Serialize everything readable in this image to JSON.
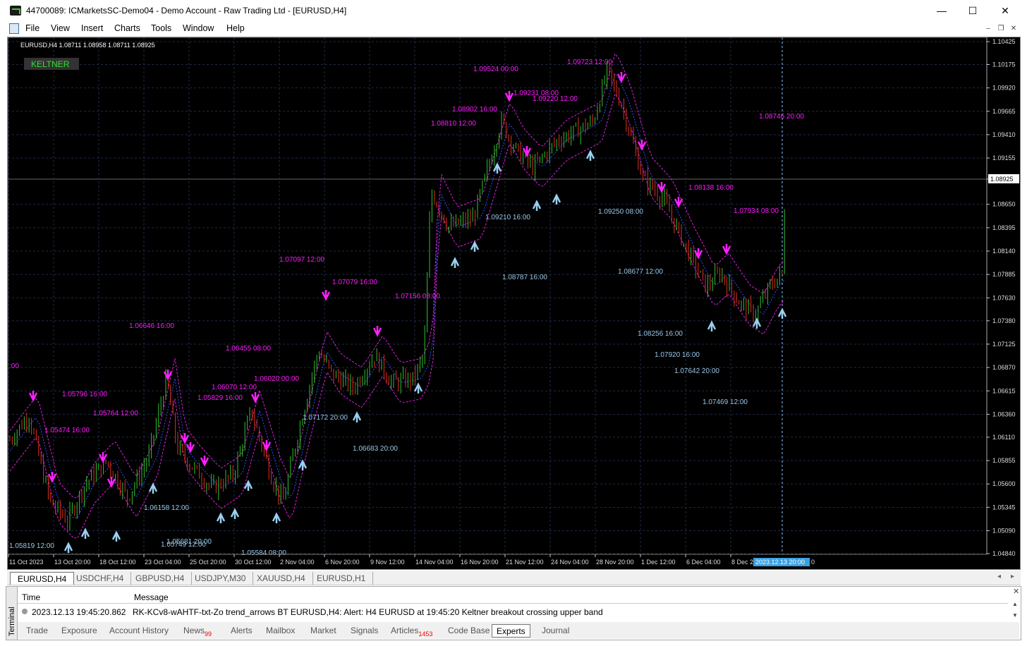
{
  "window": {
    "title": "44700089: ICMarketsSC-Demo04 - Demo Account - Raw Trading Ltd - [EURUSD,H4]",
    "minimize": "—",
    "maximize": "☐",
    "close": "✕"
  },
  "menu": [
    "File",
    "View",
    "Insert",
    "Charts",
    "Tools",
    "Window",
    "Help"
  ],
  "chart": {
    "header": "EURUSD,H4  1.08711 1.08958 1.08711 1.08925",
    "indicator_badge": "KELTNER",
    "current_price": "1.08925",
    "cursor_time": "2023.12.13 20:00",
    "price_axis": [
      "1.10425",
      "1.10175",
      "1.09920",
      "1.09665",
      "1.09410",
      "1.09155",
      "1.08925",
      "1.08650",
      "1.08395",
      "1.08140",
      "1.07885",
      "1.07630",
      "1.07380",
      "1.07125",
      "1.06870",
      "1.06615",
      "1.06360",
      "1.06110",
      "1.05855",
      "1.05600",
      "1.05345",
      "1.05090",
      "1.04840"
    ],
    "time_axis": [
      "11 Oct 2023",
      "13 Oct 20:00",
      "18 Oct 12:00",
      "23 Oct 04:00",
      "25 Oct 20:00",
      "30 Oct 12:00",
      "2 Nov 04:00",
      "6 Nov 20:00",
      "9 Nov 12:00",
      "14 Nov 04:00",
      "16 Nov 20:00",
      "21 Nov 12:00",
      "24 Nov 04:00",
      "28 Nov 20:00",
      "1 Dec 12:00",
      "6 Dec 04:00",
      "8 Dec 2"
    ],
    "time_axis_tail": "0",
    "labels_high": [
      "1.09524 00:00",
      "1.09723 12:00",
      "1.09231 08:00",
      "1.09220 12:00",
      "1.08902 16:00",
      "1.08810 12:00",
      "1.08746 20:00",
      "1.08138 16:00",
      "1.07934 08:00",
      "1.07097 12:00",
      "1.07079 16:00",
      "1.07156 08:00",
      "1.06646 16:00",
      "1.06455 08:00",
      "1.06070 12:00",
      "1.06020 00:00",
      "1.05829 16:00",
      "1.05796 16:00",
      "1.05764 12:00",
      "1.05474 16:00",
      ":00"
    ],
    "labels_low": [
      "1.09210 16:00",
      "1.09250 08:00",
      "1.08787 16:00",
      "1.08677 12:00",
      "1.08256 16:00",
      "1.07920 16:00",
      "1.07642 20:00",
      "1.07469 12:00",
      "1.07172 20:00",
      "1.06683 20:00",
      "1.06158 12:00",
      "1.05819 12:00",
      "1.05749 12:00",
      "1.05681 20:00",
      "1.05584 08:00"
    ],
    "colors": {
      "bull": "#2fc12f",
      "bear": "#e0301e",
      "grid": "#1f2a4a",
      "high_label": "#ff1aff",
      "low_label": "#9ac8e8",
      "band": "#e020e0",
      "mid": "#3050ff"
    }
  },
  "symbol_tabs": [
    "EURUSD,H4",
    "USDCHF,H4",
    "GBPUSD,H4",
    "USDJPY,M30",
    "XAUUSD,H4",
    "EURUSD,H1"
  ],
  "terminal": {
    "side_label": "Terminal",
    "col_time": "Time",
    "col_message": "Message",
    "row_time": "2023.12.13 19:45:20.862",
    "row_message": "RK-KCv8-wAHTF-txt-Zo trend_arrows BT EURUSD,H4: Alert: H4 EURUSD at 19:45:20 Keltner breakout  crossing upper band",
    "tabs": [
      "Trade",
      "Exposure",
      "Account History",
      "News",
      "Alerts",
      "Mailbox",
      "Market",
      "Signals",
      "Articles",
      "Code Base",
      "Experts",
      "Journal"
    ],
    "news_badge": "99",
    "articles_badge": "1453"
  }
}
